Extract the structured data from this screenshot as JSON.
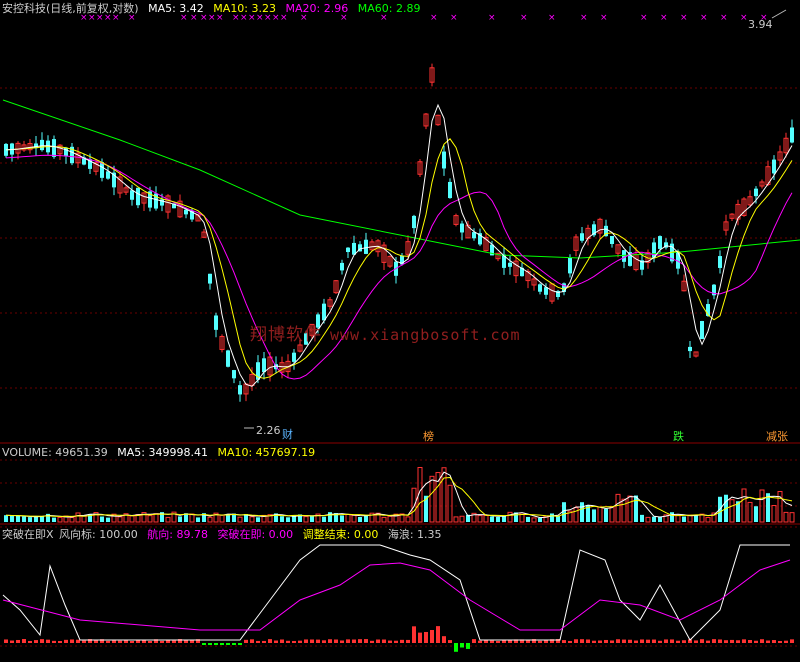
{
  "header": {
    "title": "安控科技(日线,前复权,对数)",
    "ma5": "MA5: 3.42",
    "ma10": "MA10: 3.23",
    "ma20": "MA20: 2.96",
    "ma60": "MA60: 2.89"
  },
  "price_labels": {
    "high": "3.94",
    "low": "2.26"
  },
  "event_markers": [
    {
      "label": "财"
    },
    {
      "label": "榜"
    },
    {
      "label": "跌"
    },
    {
      "label": "减张"
    }
  ],
  "volume_header": {
    "volume": "VOLUME: 49651.39",
    "ma5": "MA5: 349998.41",
    "ma10": "MA10: 457697.19"
  },
  "indicator_header": {
    "name": "突破在即X",
    "wind": "风向标: 100.00",
    "heading": "航向: 89.78",
    "breakout": "突破在即: 0.00",
    "adjust": "调整结束: 0.00",
    "wave": "海浪: 1.35"
  },
  "watermark": {
    "cn": "翔博软件",
    "url": "www.xiangbosoft.com"
  },
  "colors": {
    "up": "#ff3232",
    "down": "#54ffff",
    "ma5": "#ffffff",
    "ma10": "#ffff00",
    "ma20": "#ff00ff",
    "ma60": "#00ff00",
    "grid": "#8b0000",
    "cross": "#ff00ff"
  }
}
